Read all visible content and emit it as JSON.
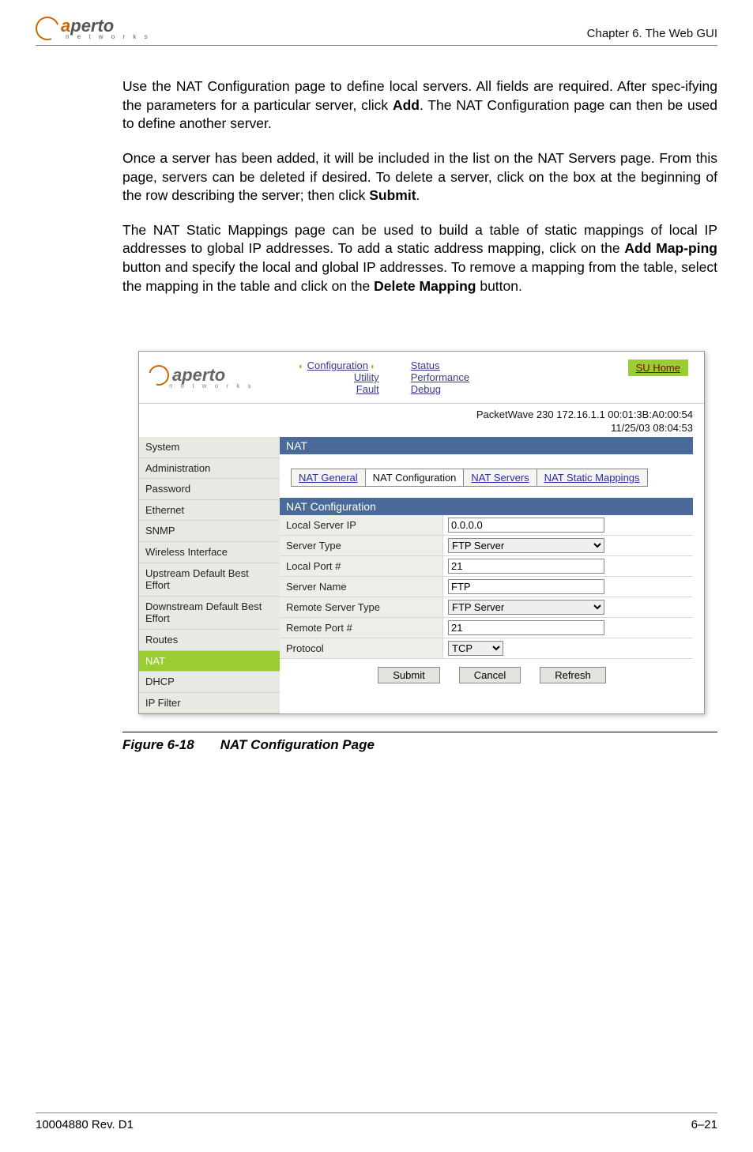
{
  "doc": {
    "logo_main": "aperto",
    "logo_sub": "n e t w o r k s",
    "chapter": "Chapter 6.  The Web GUI",
    "footer_left": "10004880 Rev. D1",
    "footer_right": "6–21",
    "figure_label": "Figure 6-18",
    "figure_title": "NAT Configuration Page"
  },
  "para": {
    "p1a": "Use the NAT Configuration page to define local servers. All fields are required. After spec-ifying the parameters for a particular server, click ",
    "p1_bold1": "Add",
    "p1b": ". The NAT Configuration page can then be used to define another server.",
    "p2a": "Once a server has been added, it will be included in the list on the NAT Servers page. From this page, servers can be deleted if desired. To delete a server, click on the box at the beginning of the row describing the server; then click ",
    "p2_bold1": "Submit",
    "p2b": ".",
    "p3a": "The NAT Static Mappings page can be used to build a table of static mappings of local IP addresses to global IP addresses. To add a static address mapping, click on the ",
    "p3_bold1": "Add Map-ping",
    "p3b": " button and specify the local and global IP addresses. To remove a mapping from the table, select the mapping in the table and click on the ",
    "p3_bold2": "Delete Mapping",
    "p3c": " button."
  },
  "gui": {
    "logo_main": "aperto",
    "logo_sub": "n e t w o r k s",
    "top_nav_col1": [
      "Configuration",
      "Utility",
      "Fault"
    ],
    "top_nav_col2": [
      "Status",
      "Performance",
      "Debug"
    ],
    "home_label": "SU Home",
    "device_line": "PacketWave 230    172.16.1.1    00:01:3B:A0:00:54",
    "datetime_line": "11/25/03    08:04:53",
    "sidebar": [
      "System",
      "Administration",
      "Password",
      "Ethernet",
      "SNMP",
      "Wireless Interface",
      "Upstream Default Best Effort",
      "Downstream Default Best Effort",
      "Routes",
      "NAT",
      "DHCP",
      "IP Filter"
    ],
    "sidebar_active_index": 9,
    "section_title": "NAT",
    "tabs": [
      "NAT General",
      "NAT Configuration",
      "NAT Servers",
      "NAT Static Mappings"
    ],
    "tab_active_index": 1,
    "panel_title": "NAT Configuration",
    "fields": {
      "local_server_ip": {
        "label": "Local Server IP",
        "value": "0.0.0.0"
      },
      "server_type": {
        "label": "Server Type",
        "value": "FTP Server"
      },
      "local_port": {
        "label": "Local Port #",
        "value": "21"
      },
      "server_name": {
        "label": "Server Name",
        "value": "FTP"
      },
      "remote_server_type": {
        "label": "Remote Server Type",
        "value": "FTP Server"
      },
      "remote_port": {
        "label": "Remote Port #",
        "value": "21"
      },
      "protocol": {
        "label": "Protocol",
        "value": "TCP"
      }
    },
    "buttons": {
      "submit": "Submit",
      "cancel": "Cancel",
      "refresh": "Refresh"
    }
  }
}
